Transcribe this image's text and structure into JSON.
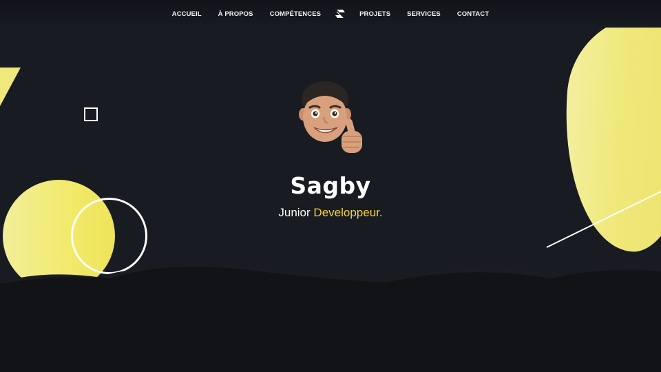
{
  "nav": {
    "items_left": [
      {
        "label": "ACCUEIL"
      },
      {
        "label": "À PROPOS"
      },
      {
        "label": "COMPÉTENCES"
      }
    ],
    "items_right": [
      {
        "label": "PROJETS"
      },
      {
        "label": "SERVICES"
      },
      {
        "label": "CONTACT"
      }
    ],
    "logo_icon": "s-logo-icon"
  },
  "hero": {
    "avatar_icon": "memoji-thumbs-up-avatar",
    "name": "Sagby",
    "role_prefix": "Junior",
    "role_highlight": "Developpeur",
    "role_suffix": "."
  },
  "colors": {
    "background": "#181b22",
    "accent": "#f4d23b",
    "yellow_shape": "#efe87a",
    "wave": "#121316"
  }
}
